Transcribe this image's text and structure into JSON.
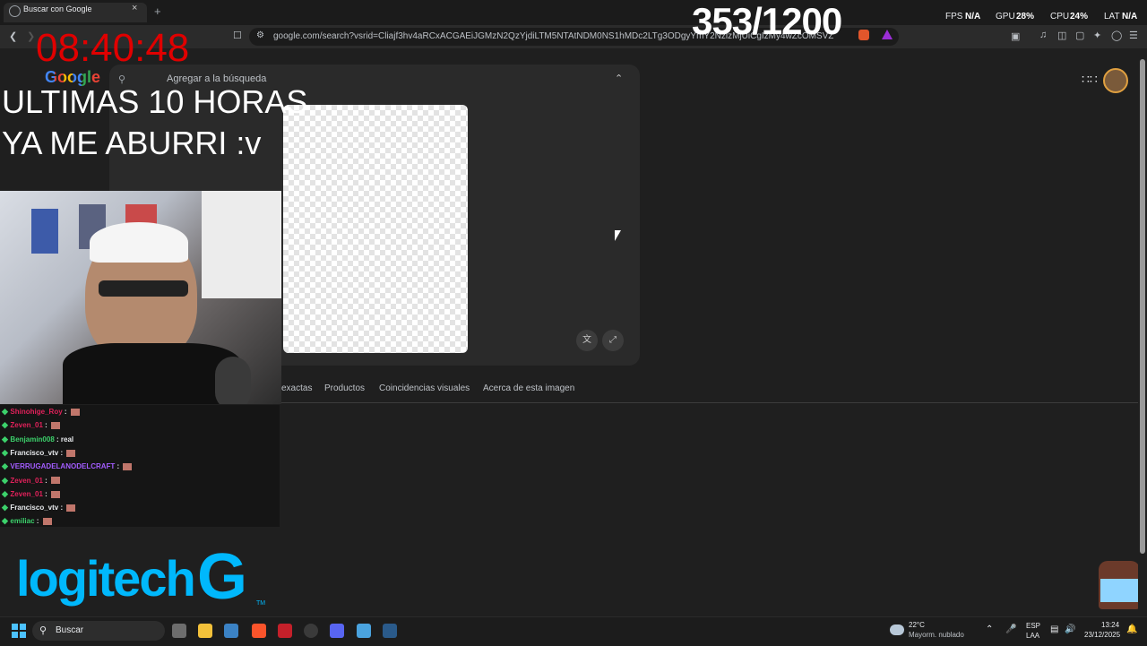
{
  "browser": {
    "tab_title": "Buscar con Google",
    "tab_close": "×",
    "new_tab": "+",
    "url": "google.com/search?vsrid=Cliajf3hv4aRCxACGAEiJGMzN2QzYjdiLTM5NTAtNDM0NS1hMDc2LTg3ODgyYmY2NzlzMjUiCgIzMy4wZcOMSVZnKq1JE0&vsint=CA"
  },
  "stream_overlay": {
    "counter": "353/1200",
    "fps_label": "FPS",
    "fps_value": "N/A",
    "gpu_label": "GPU",
    "gpu_value": "28%",
    "cpu_label": "CPU",
    "cpu_value": "24%",
    "lat_label": "LAT",
    "lat_value": "N/A",
    "clock": "08:40:48",
    "line1": "ULTIMAS 10 HORAS",
    "line2": "YA ME ABURRI :v",
    "logo_text": "logitech",
    "logo_g": "G",
    "logo_tm": "TM"
  },
  "google": {
    "logo": "Google",
    "search_placeholder": "Agregar a la búsqueda",
    "tabs": [
      "exactas",
      "Productos",
      "Coincidencias visuales",
      "Acerca de esta imagen"
    ]
  },
  "chat": [
    {
      "user": "Shinohige_Roy",
      "msg": "",
      "color": "#e0215a"
    },
    {
      "user": "Zeven_01",
      "msg": "",
      "color": "#e0215a"
    },
    {
      "user": "Benjamin008",
      "msg": "real",
      "color": "#3cd16b"
    },
    {
      "user": "Francisco_vtv",
      "msg": "",
      "color": "#e8eaed"
    },
    {
      "user": "VERRUGADELANODELCRAFT",
      "msg": "",
      "color": "#a35cff"
    },
    {
      "user": "Zeven_01",
      "msg": "",
      "color": "#e0215a"
    },
    {
      "user": "Zeven_01",
      "msg": "",
      "color": "#e0215a"
    },
    {
      "user": "Francisco_vtv",
      "msg": "",
      "color": "#e8eaed"
    },
    {
      "user": "emiliac",
      "msg": "",
      "color": "#3cd16b"
    }
  ],
  "taskbar": {
    "search_label": "Buscar",
    "weather_temp": "22°C",
    "weather_desc": "Mayorm. nublado",
    "lang": "ESP",
    "lang2": "LAA",
    "time": "13:24",
    "date": "23/12/2025"
  }
}
